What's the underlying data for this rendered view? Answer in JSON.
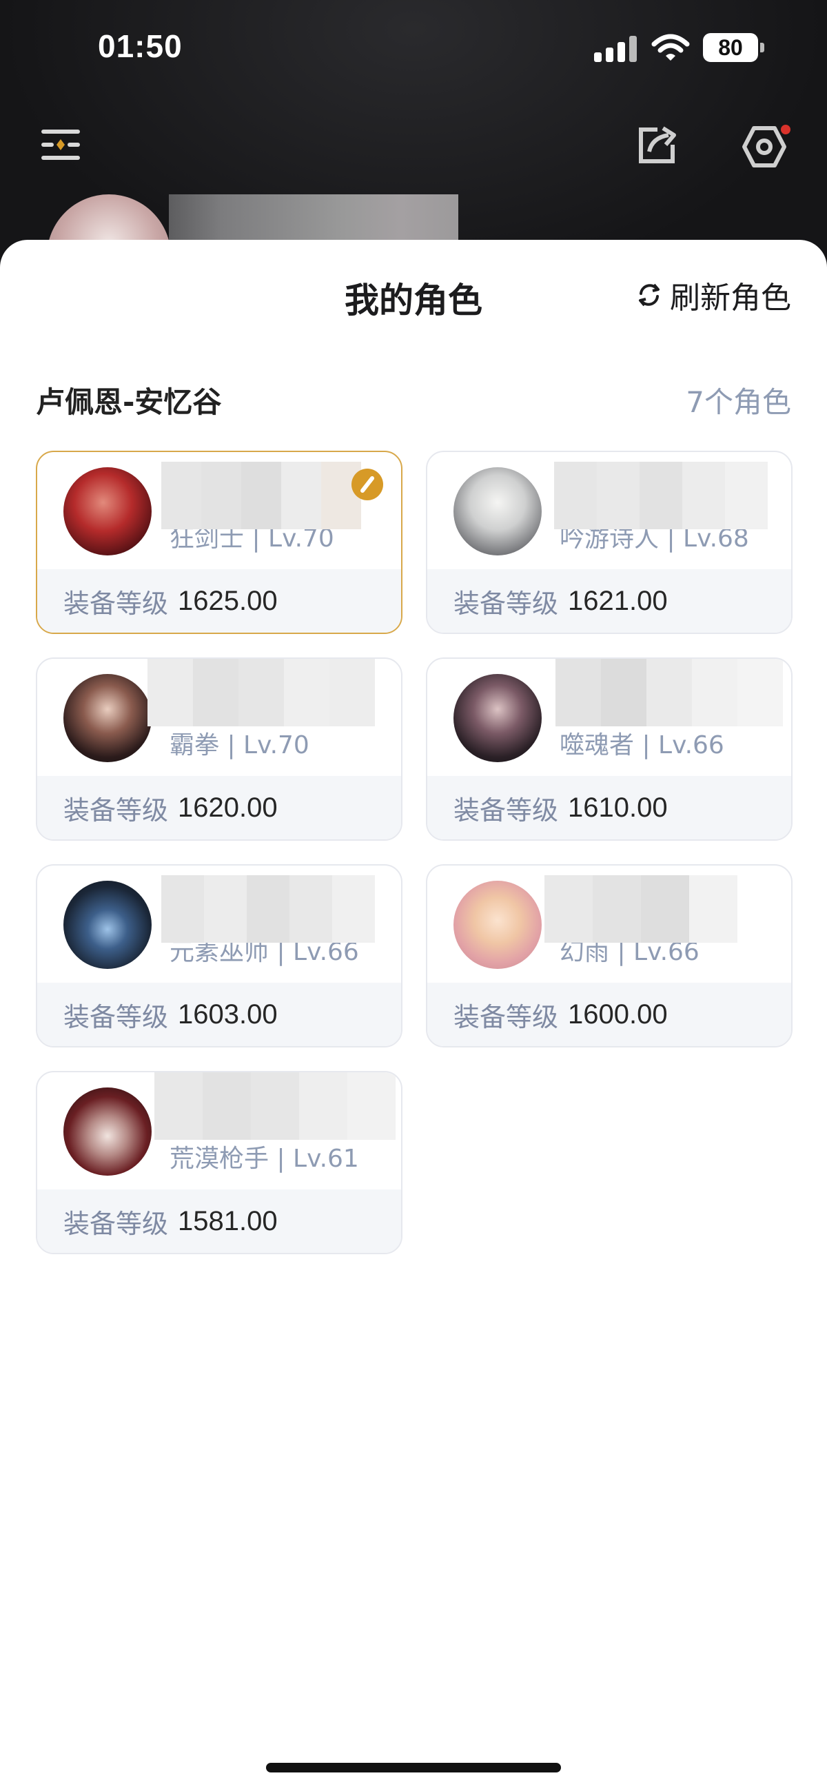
{
  "status_bar": {
    "time": "01:50",
    "battery": "80"
  },
  "sheet": {
    "title": "我的角色",
    "refresh_label": "刷新角色"
  },
  "server": {
    "name": "卢佩恩-安忆谷",
    "count": "7个角色"
  },
  "equip_label": "装备等级",
  "characters": [
    {
      "class_level": "狂剑士 | Lv.70",
      "equip": "1625.00",
      "selected": true
    },
    {
      "class_level": "吟游诗人 | Lv.68",
      "equip": "1621.00"
    },
    {
      "class_level": "霸拳 | Lv.70",
      "equip": "1620.00"
    },
    {
      "class_level": "噬魂者 | Lv.66",
      "equip": "1610.00"
    },
    {
      "class_level": "元素巫师 | Lv.66",
      "equip": "1603.00"
    },
    {
      "class_level": "幻雨 | Lv.66",
      "equip": "1600.00"
    },
    {
      "class_level": "荒漠枪手 | Lv.61",
      "equip": "1581.00"
    }
  ],
  "colors": {
    "accent": "#d79a27",
    "label": "#8e9bb3",
    "card_border": "#e6e8ee"
  }
}
